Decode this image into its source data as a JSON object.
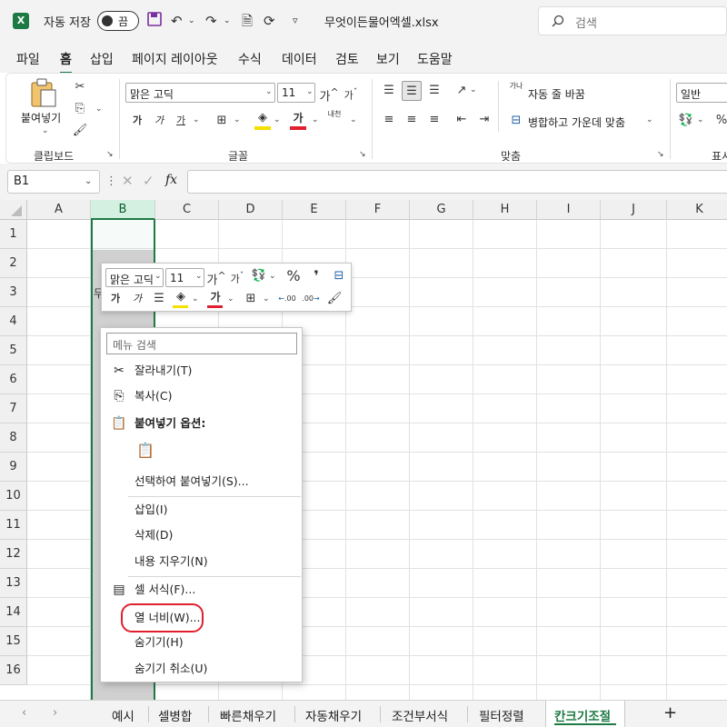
{
  "titlebar": {
    "autosave_label": "자동 저장",
    "autosave_state": "끔",
    "filename": "무엇이든물어엑셀.xlsx",
    "search_placeholder": "검색"
  },
  "menu_tabs": [
    "파일",
    "홈",
    "삽입",
    "페이지 레이아웃",
    "수식",
    "데이터",
    "검토",
    "보기",
    "도움말"
  ],
  "active_menu_tab": "홈",
  "ribbon": {
    "clipboard": {
      "paste_label": "붙여넣기",
      "group_label": "클립보드"
    },
    "font": {
      "font_name": "맑은 고딕",
      "font_size": "11",
      "group_label": "글꼴",
      "bold": "가",
      "italic": "가",
      "underline": "가",
      "font_color": "가",
      "grow": "가",
      "shrink": "가",
      "phonetic": "내천"
    },
    "alignment": {
      "wrap_text": "자동 줄 바꿈",
      "merge_center": "병합하고 가운데 맞춤",
      "group_label": "맞춤",
      "wrap_icon": "가나"
    },
    "number": {
      "format": "일반",
      "group_label": "표시",
      "percent": "%"
    }
  },
  "formula_bar": {
    "name_box": "B1",
    "fx": "fx"
  },
  "columns": [
    "A",
    "B",
    "C",
    "D",
    "E",
    "F",
    "G",
    "H",
    "I",
    "J",
    "K"
  ],
  "rows": [
    "1",
    "2",
    "3",
    "4",
    "5",
    "6",
    "7",
    "8",
    "9",
    "10",
    "11",
    "12",
    "13",
    "14",
    "15",
    "16"
  ],
  "selected_column": "B",
  "mini_toolbar": {
    "font_name": "맑은 고딕",
    "font_size": "11",
    "bold": "가",
    "italic": "가",
    "font_color": "가",
    "grow": "가",
    "shrink": "가",
    "percent": "%",
    "comma": "❜",
    "inc_decimal": ".00",
    "dec_decimal": ".00"
  },
  "cell_partial_text": "무",
  "context_menu": {
    "search_placeholder": "메뉴 검색",
    "items": [
      {
        "label": "잘라내기(T)",
        "icon": "scissors-icon"
      },
      {
        "label": "복사(C)",
        "icon": "copy-icon"
      },
      {
        "label": "붙여넣기 옵션:",
        "icon": "paste-icon"
      },
      {
        "label": "선택하여 붙여넣기(S)...",
        "icon": ""
      },
      {
        "label": "삽입(I)",
        "icon": ""
      },
      {
        "label": "삭제(D)",
        "icon": ""
      },
      {
        "label": "내용 지우기(N)",
        "icon": ""
      },
      {
        "label": "셀 서식(F)...",
        "icon": "format-cells-icon"
      },
      {
        "label": "열 너비(W)...",
        "icon": ""
      },
      {
        "label": "숨기기(H)",
        "icon": ""
      },
      {
        "label": "숨기기 취소(U)",
        "icon": ""
      }
    ]
  },
  "sheet_tabs": [
    "예시",
    "셀병합",
    "빠른채우기",
    "자동채우기",
    "조건부서식",
    "필터정렬",
    "칸크기조절"
  ],
  "active_sheet": "칸크기조절",
  "colors": {
    "accent": "#1d7a45",
    "highlight_ring": "#e0202e",
    "font_color_bar": "#e0202e",
    "fill_color_bar": "#f5e000"
  }
}
